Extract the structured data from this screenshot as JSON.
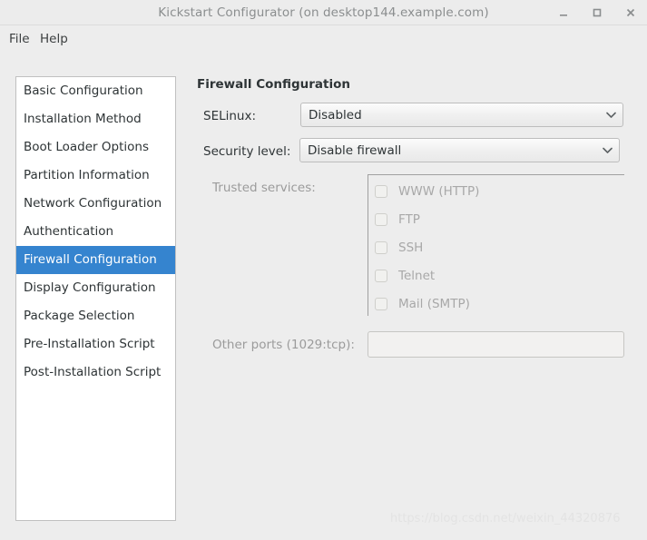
{
  "window": {
    "title": "Kickstart Configurator (on desktop144.example.com)",
    "controls": {
      "minimize": "minimize-window",
      "maximize": "maximize-window",
      "close": "close-window"
    }
  },
  "menubar": {
    "items": [
      {
        "label": "File"
      },
      {
        "label": "Help"
      }
    ]
  },
  "sidebar": {
    "items": [
      {
        "label": "Basic Configuration",
        "selected": false
      },
      {
        "label": "Installation Method",
        "selected": false
      },
      {
        "label": "Boot Loader Options",
        "selected": false
      },
      {
        "label": "Partition Information",
        "selected": false
      },
      {
        "label": "Network Configuration",
        "selected": false
      },
      {
        "label": "Authentication",
        "selected": false
      },
      {
        "label": "Firewall Configuration",
        "selected": true
      },
      {
        "label": "Display Configuration",
        "selected": false
      },
      {
        "label": "Package Selection",
        "selected": false
      },
      {
        "label": "Pre-Installation Script",
        "selected": false
      },
      {
        "label": "Post-Installation Script",
        "selected": false
      }
    ],
    "selected_color": "#3584cf"
  },
  "main": {
    "title": "Firewall Configuration",
    "selinux": {
      "label": "SELinux:",
      "value": "Disabled"
    },
    "security_level": {
      "label": "Security level:",
      "value": "Disable firewall"
    },
    "trusted_services": {
      "label": "Trusted services:",
      "items": [
        {
          "label": "WWW (HTTP)",
          "checked": false
        },
        {
          "label": "FTP",
          "checked": false
        },
        {
          "label": "SSH",
          "checked": false
        },
        {
          "label": "Telnet",
          "checked": false
        },
        {
          "label": "Mail (SMTP)",
          "checked": false
        }
      ]
    },
    "other_ports": {
      "label": "Other ports (1029:tcp):",
      "value": "",
      "placeholder": ""
    }
  },
  "watermark": {
    "text": "https://blog.csdn.net/weixin_44320876"
  }
}
